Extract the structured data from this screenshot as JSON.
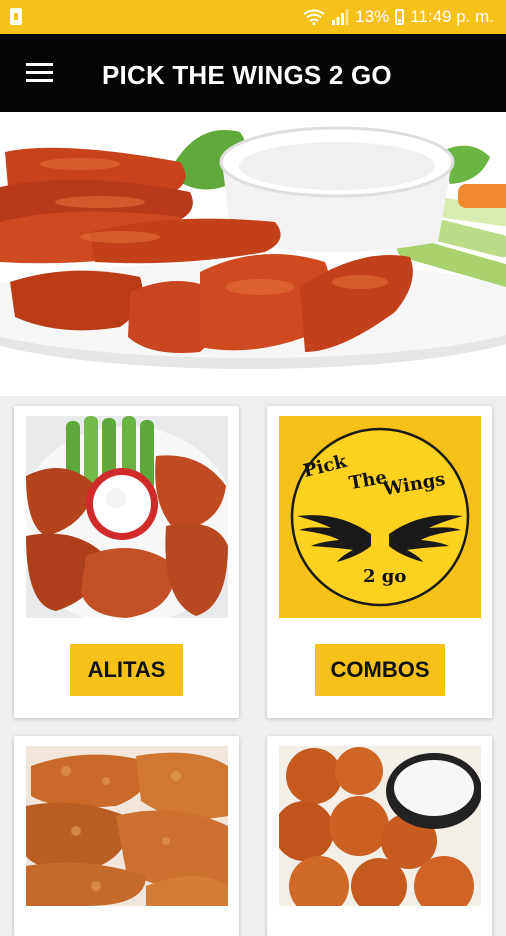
{
  "status_bar": {
    "battery_percent": "13%",
    "time": "11:49 p. m.",
    "icons": [
      "sim-alert-icon",
      "wifi-icon",
      "signal-icon",
      "battery-icon"
    ]
  },
  "app_bar": {
    "title": "PICK THE WINGS 2 GO",
    "menu_icon": "hamburger-menu-icon"
  },
  "hero": {
    "image": "wings-with-dip-and-celery-photo"
  },
  "categories": [
    {
      "label": "ALITAS",
      "image": "alitas-photo"
    },
    {
      "label": "COMBOS",
      "image": "pick-the-wings-logo"
    },
    {
      "label": "",
      "image": "tenders-photo"
    },
    {
      "label": "",
      "image": "boneless-photo"
    }
  ],
  "logo": {
    "line1": "Pick",
    "line2": "The",
    "line3": "Wings",
    "line4": "2 go"
  },
  "colors": {
    "accent": "#f6c21a",
    "app_bar": "#050505",
    "background": "#efefef"
  }
}
